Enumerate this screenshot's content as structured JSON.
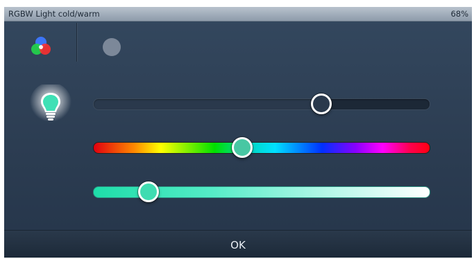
{
  "dialog": {
    "title": "RGBW Light cold/warm",
    "brightness_readout": "68%"
  },
  "modes": {
    "rgb_icon": "rgb-color-circles-icon",
    "white_icon": "white-dot-icon"
  },
  "bulb": {
    "icon": "light-bulb-icon",
    "color": "#3fe0b5"
  },
  "sliders": {
    "brightness": {
      "value_fraction": 0.68
    },
    "hue": {
      "value_fraction": 0.445,
      "knob_color": "#48c7a3"
    },
    "color_temperature": {
      "value_fraction": 0.165,
      "start_color": "#1edda9",
      "end_color": "#ffffff"
    }
  },
  "footer": {
    "ok_label": "OK"
  },
  "colors": {
    "panel": "#2f4155",
    "titlebar": "#a9b4c1",
    "accent": "#3fe0b5"
  }
}
